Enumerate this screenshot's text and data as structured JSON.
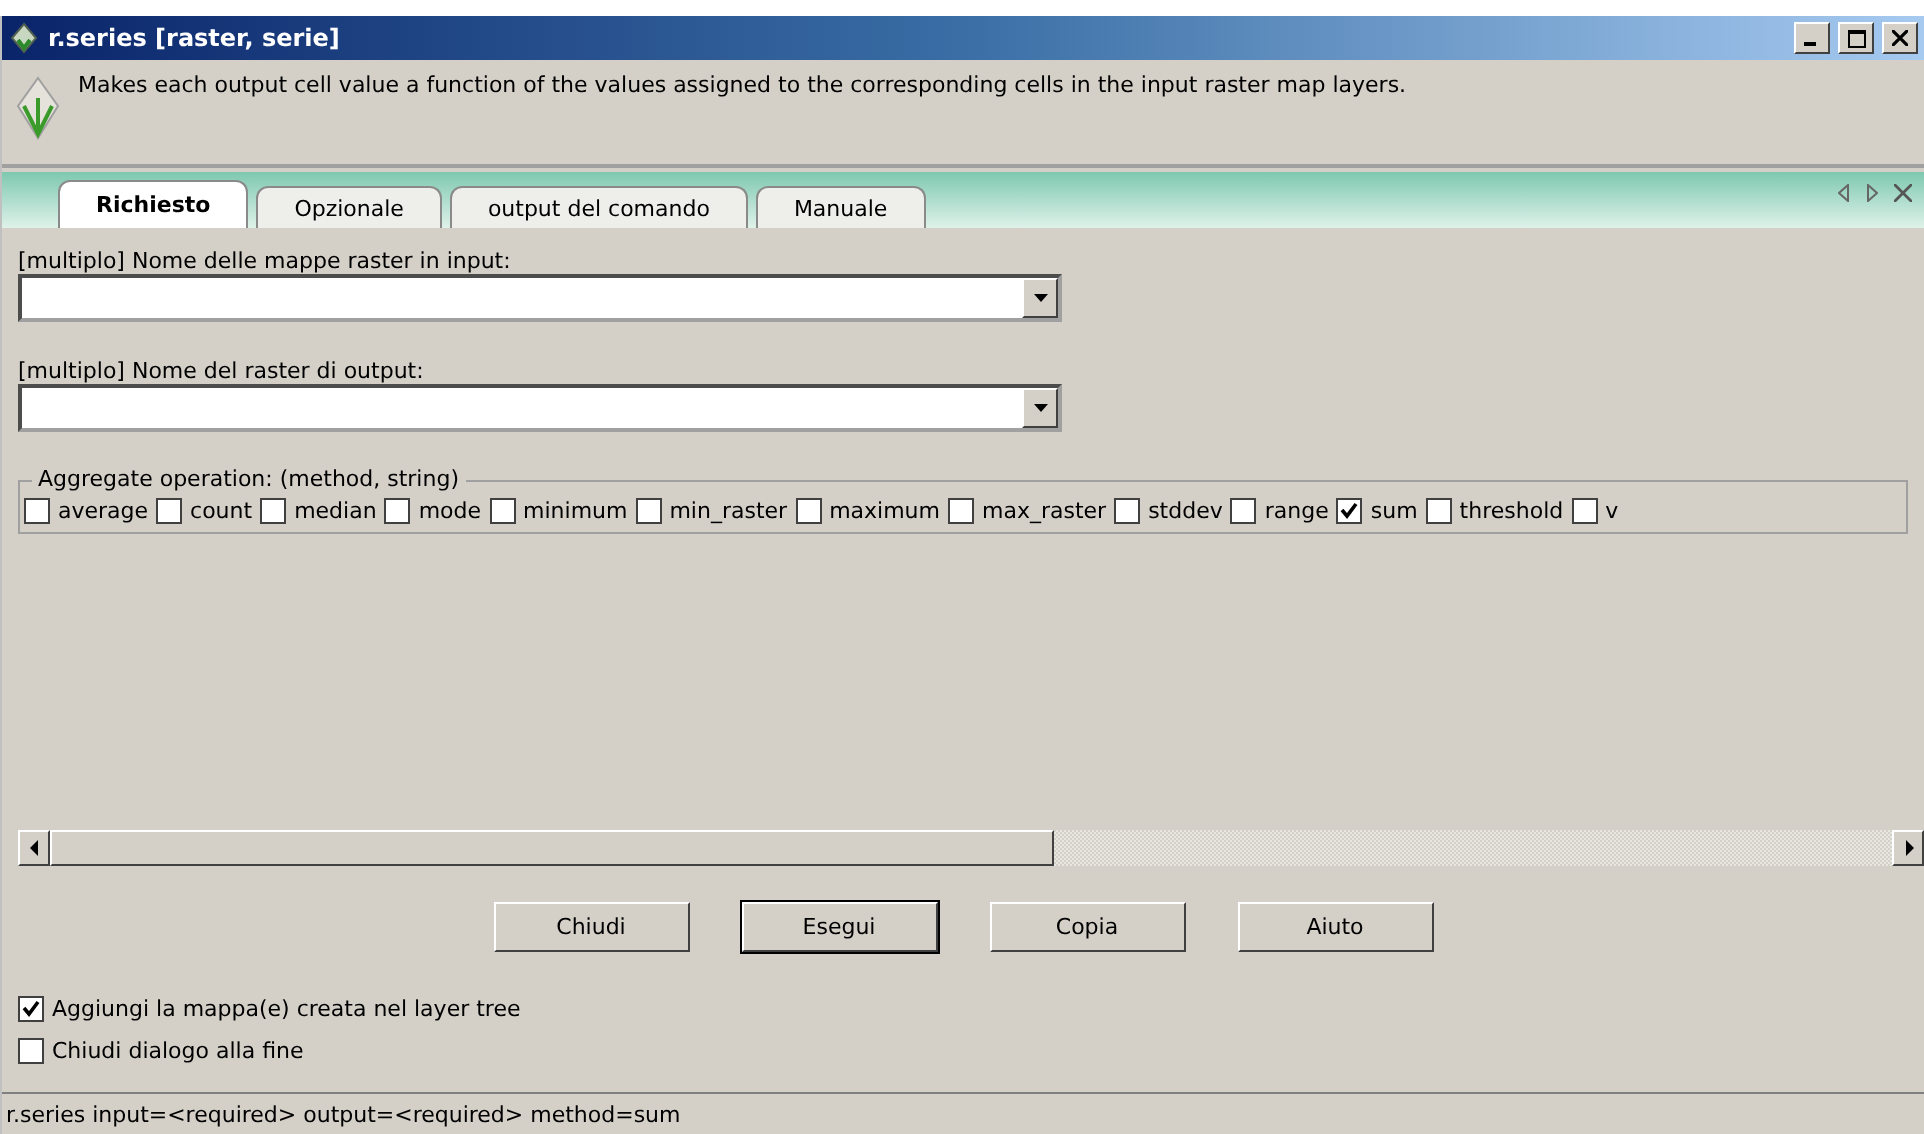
{
  "window": {
    "title": "r.series [raster, serie]"
  },
  "description": "Makes each output cell value a function of the values assigned to the corresponding cells in the input raster map layers.",
  "tabs": [
    {
      "label": "Richiesto",
      "selected": true
    },
    {
      "label": "Opzionale",
      "selected": false
    },
    {
      "label": "output del comando",
      "selected": false
    },
    {
      "label": "Manuale",
      "selected": false
    }
  ],
  "fields": [
    {
      "label": "[multiplo] Nome delle mappe raster in input:"
    },
    {
      "label": "[multiplo] Nome del raster di output:"
    }
  ],
  "aggregate": {
    "title": "Aggregate operation: (method, string)",
    "options": [
      {
        "label": "average",
        "checked": false
      },
      {
        "label": "count",
        "checked": false
      },
      {
        "label": "median",
        "checked": false
      },
      {
        "label": "mode",
        "checked": false
      },
      {
        "label": "minimum",
        "checked": false
      },
      {
        "label": "min_raster",
        "checked": false
      },
      {
        "label": "maximum",
        "checked": false
      },
      {
        "label": "max_raster",
        "checked": false
      },
      {
        "label": "stddev",
        "checked": false
      },
      {
        "label": "range",
        "checked": false
      },
      {
        "label": "sum",
        "checked": true
      },
      {
        "label": "threshold",
        "checked": false
      },
      {
        "label": "v",
        "checked": false
      }
    ]
  },
  "buttons": [
    {
      "label": "Chiudi",
      "selected": false
    },
    {
      "label": "Esegui",
      "selected": true
    },
    {
      "label": "Copia",
      "selected": false
    },
    {
      "label": "Aiuto",
      "selected": false
    }
  ],
  "options": [
    {
      "label": "Aggiungi la mappa(e) creata nel layer tree",
      "checked": true
    },
    {
      "label": "Chiudi dialogo alla fine",
      "checked": false
    }
  ],
  "status_bar": "r.series input=<required> output=<required> method=sum"
}
